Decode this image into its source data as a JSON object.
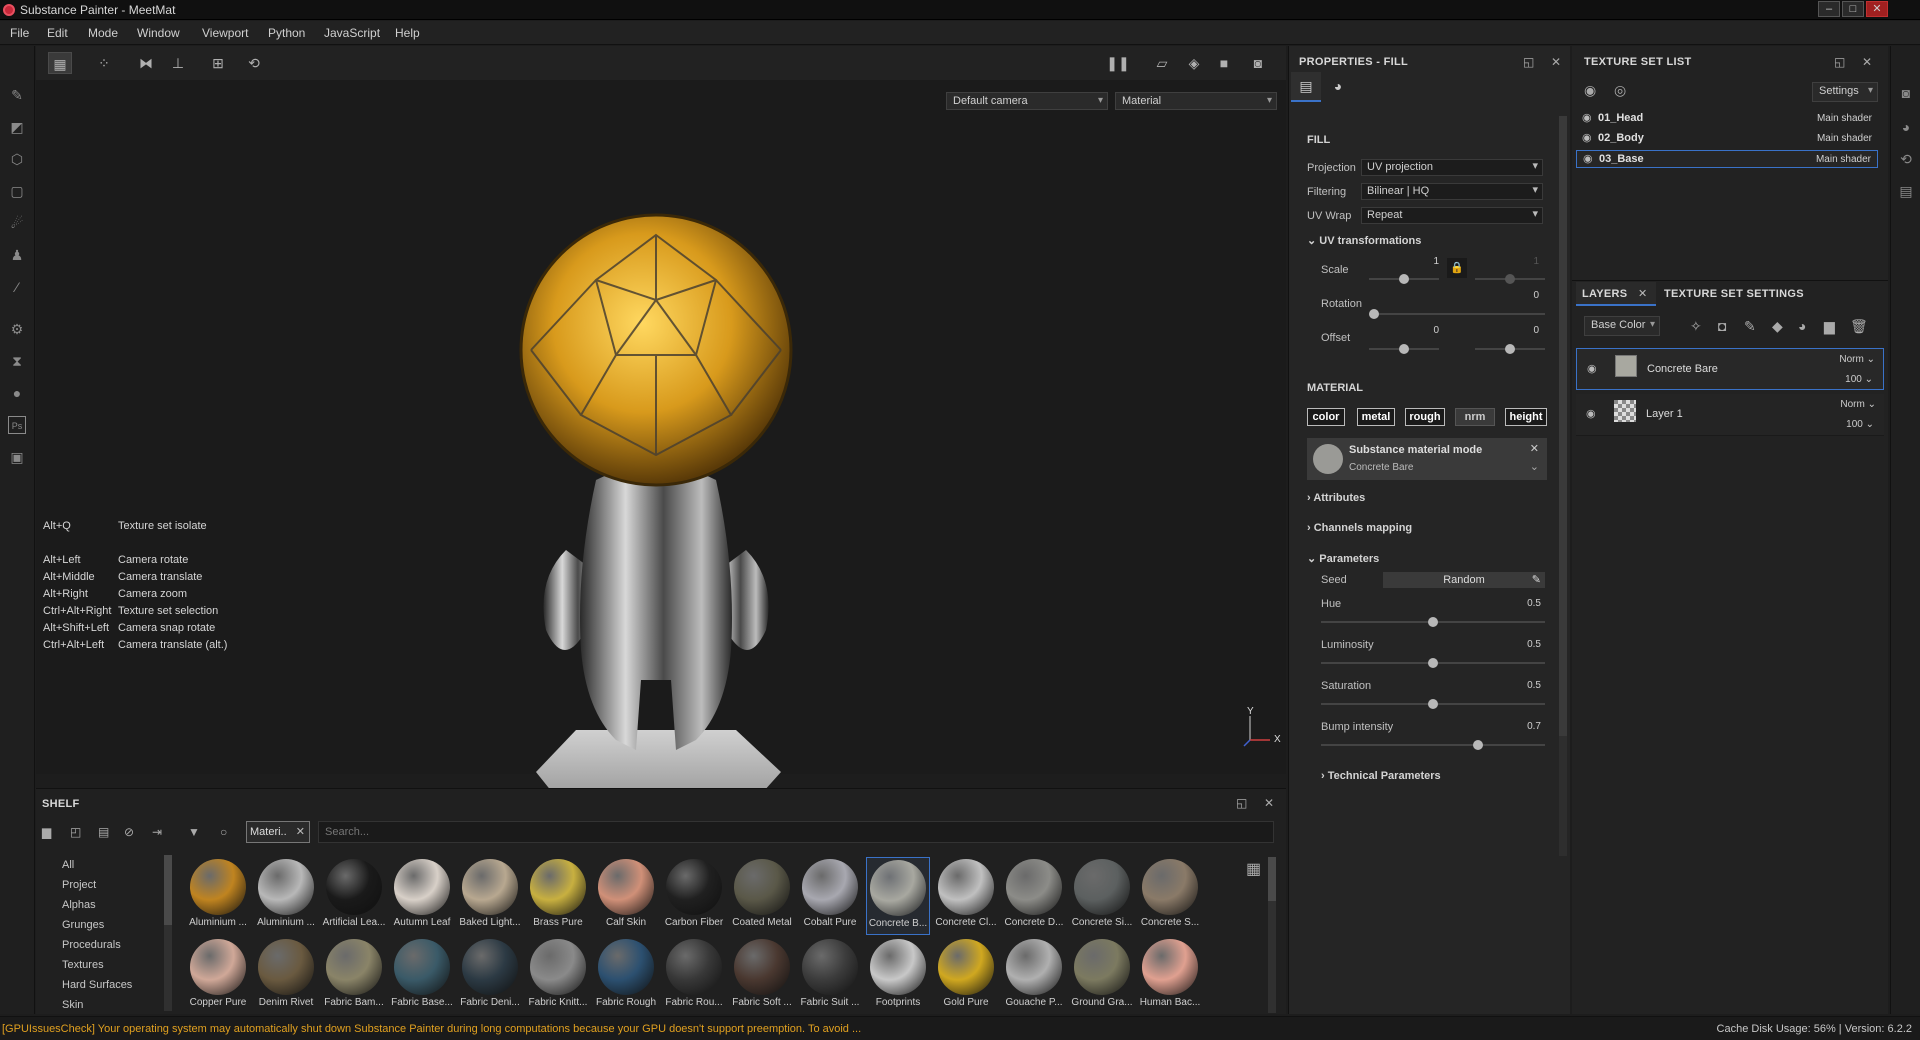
{
  "window": {
    "title": "Substance Painter - MeetMat",
    "minimize": "–",
    "maximize": "□",
    "close": "✕"
  },
  "menu": [
    "File",
    "Edit",
    "Mode",
    "Window",
    "Viewport",
    "Python",
    "JavaScript",
    "Help"
  ],
  "viewport": {
    "camera_select": "Default camera",
    "mode_select": "Material",
    "axis_y": "Y",
    "axis_x": "X",
    "shortcuts": [
      {
        "keys": "Alt+Q",
        "action": "Texture set isolate"
      },
      {
        "keys": "Alt+Left",
        "action": "Camera rotate"
      },
      {
        "keys": "Alt+Middle",
        "action": "Camera translate"
      },
      {
        "keys": "Alt+Right",
        "action": "Camera zoom"
      },
      {
        "keys": "Ctrl+Alt+Right",
        "action": "Texture set selection"
      },
      {
        "keys": "Alt+Shift+Left",
        "action": "Camera snap rotate"
      },
      {
        "keys": "Ctrl+Alt+Left",
        "action": "Camera translate (alt.)"
      }
    ]
  },
  "shelf": {
    "title": "SHELF",
    "filter_chip": "Materi..",
    "search_placeholder": "Search...",
    "categories": [
      "All",
      "Project",
      "Alphas",
      "Grunges",
      "Procedurals",
      "Textures",
      "Hard Surfaces",
      "Skin"
    ],
    "materials": [
      {
        "label": "Aluminium ...",
        "color": "#c08420"
      },
      {
        "label": "Aluminium ...",
        "color": "#b8b8b8"
      },
      {
        "label": "Artificial Lea...",
        "color": "#1a1a1a"
      },
      {
        "label": "Autumn Leaf",
        "color": "#d8d0c8"
      },
      {
        "label": "Baked Light...",
        "color": "#b8a890"
      },
      {
        "label": "Brass Pure",
        "color": "#c8b040"
      },
      {
        "label": "Calf Skin",
        "color": "#d09078"
      },
      {
        "label": "Carbon Fiber",
        "color": "#202020"
      },
      {
        "label": "Coated Metal",
        "color": "#5a5848"
      },
      {
        "label": "Cobalt Pure",
        "color": "#a8a8b0"
      },
      {
        "label": "Concrete B...",
        "color": "#a8a8a0"
      },
      {
        "label": "Concrete Cl...",
        "color": "#c0c0c0"
      },
      {
        "label": "Concrete D...",
        "color": "#8c8c88"
      },
      {
        "label": "Concrete Si...",
        "color": "#5c6060"
      },
      {
        "label": "Concrete S...",
        "color": "#8a7a68"
      },
      {
        "label": "Copper Pure",
        "color": "#d0a898"
      },
      {
        "label": "Denim Rivet",
        "color": "#6a5a40"
      },
      {
        "label": "Fabric Bam...",
        "color": "#8a8468"
      },
      {
        "label": "Fabric Base...",
        "color": "#3a5a68"
      },
      {
        "label": "Fabric Deni...",
        "color": "#2c3a44"
      },
      {
        "label": "Fabric Knitt...",
        "color": "#8a8a8a"
      },
      {
        "label": "Fabric Rough",
        "color": "#2c5070"
      },
      {
        "label": "Fabric Rou...",
        "color": "#383838"
      },
      {
        "label": "Fabric Soft ...",
        "color": "#4a3830"
      },
      {
        "label": "Fabric Suit ...",
        "color": "#3c3c3c"
      },
      {
        "label": "Footprints",
        "color": "#c8c8c8"
      },
      {
        "label": "Gold Pure",
        "color": "#d0a820"
      },
      {
        "label": "Gouache P...",
        "color": "#b0b0b0"
      },
      {
        "label": "Ground Gra...",
        "color": "#7c7a60"
      },
      {
        "label": "Human Bac...",
        "color": "#e0a090"
      }
    ]
  },
  "properties": {
    "title": "PROPERTIES - FILL",
    "fill_header": "FILL",
    "projection": {
      "label": "Projection",
      "value": "UV projection"
    },
    "filtering": {
      "label": "Filtering",
      "value": "Bilinear | HQ"
    },
    "uvwrap": {
      "label": "UV Wrap",
      "value": "Repeat"
    },
    "uv_transform_header": "UV transformations",
    "scale": {
      "label": "Scale",
      "value": "1",
      "value2": "1"
    },
    "rotation": {
      "label": "Rotation",
      "value": "0"
    },
    "offset": {
      "label": "Offset",
      "value": "0",
      "value2": "0"
    },
    "material_header": "MATERIAL",
    "channels": [
      "color",
      "metal",
      "rough",
      "nrm",
      "height"
    ],
    "substance_mode": "Substance material mode",
    "substance_name": "Concrete Bare",
    "attributes": "Attributes",
    "channels_mapping": "Channels mapping",
    "parameters": "Parameters",
    "seed": {
      "label": "Seed",
      "value": "Random"
    },
    "hue": {
      "label": "Hue",
      "value": "0.5",
      "level": 0.5
    },
    "luminosity": {
      "label": "Luminosity",
      "value": "0.5",
      "level": 0.5
    },
    "saturation": {
      "label": "Saturation",
      "value": "0.5",
      "level": 0.5
    },
    "bump": {
      "label": "Bump intensity",
      "value": "0.7",
      "level": 0.7
    },
    "technical": "Technical Parameters"
  },
  "texture_sets": {
    "title": "TEXTURE SET LIST",
    "settings": "Settings",
    "items": [
      {
        "name": "01_Head",
        "shader": "Main shader"
      },
      {
        "name": "02_Body",
        "shader": "Main shader"
      },
      {
        "name": "03_Base",
        "shader": "Main shader"
      }
    ]
  },
  "layers": {
    "tab_layers": "LAYERS",
    "tab_settings": "TEXTURE SET SETTINGS",
    "channel_select": "Base Color",
    "items": [
      {
        "name": "Concrete Bare",
        "blend": "Norm",
        "opacity": "100"
      },
      {
        "name": "Layer 1",
        "blend": "Norm",
        "opacity": "100"
      }
    ]
  },
  "status": {
    "warning": "[GPUIssuesCheck] Your operating system may automatically shut down Substance Painter during long computations because your GPU doesn't support preemption. To avoid ...",
    "info": "Cache Disk Usage:   56% | Version: 6.2.2"
  }
}
